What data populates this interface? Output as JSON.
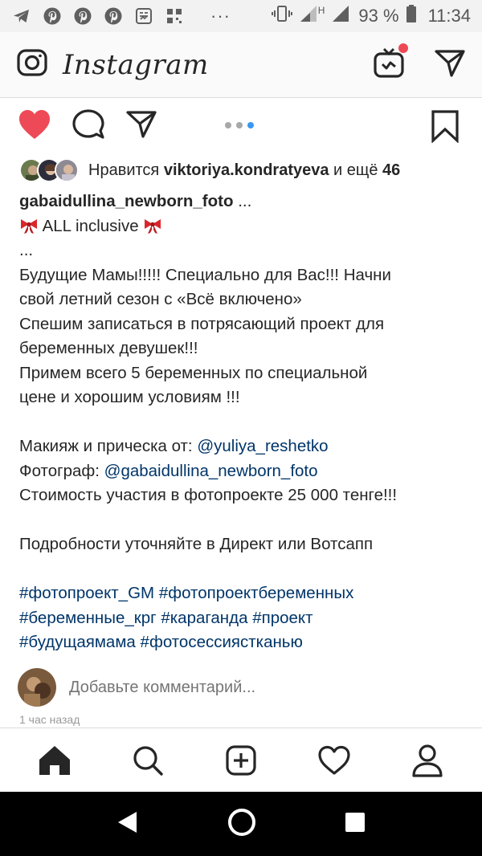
{
  "status_bar": {
    "icons": [
      "telegram-icon",
      "pinterest-icon",
      "pinterest-icon",
      "pinterest-icon",
      "screenshot-icon",
      "qr-icon"
    ],
    "more": "···",
    "network": "H",
    "battery": "93 %",
    "time": "11:34"
  },
  "app": {
    "title": "Instagram"
  },
  "post": {
    "carousel": {
      "count": 3,
      "active_index": 2
    },
    "likes": {
      "prefix": "Нравится",
      "user": "viktoriya.kondratyeva",
      "suffix": "и ещё",
      "count": "46"
    },
    "caption": {
      "username": "gabaidullina_newborn_foto",
      "ellipsis": " ...",
      "title": "ALL inclusive",
      "dots": "...",
      "lines": [
        "Будущие Мамы!!!!! Специально для Вас!!! Начни",
        "свой летний сезон с «Всё включено»",
        "Спешим записаться в потрясающий проект для",
        "беременных девушек!!!",
        "Примем всего 5 беременных по специальной",
        "цене и хорошим условиям !!!"
      ],
      "makeup_label": "Макияж и прическа от: ",
      "makeup_link": "@yuliya_reshetko",
      "photo_label": "Фотограф: ",
      "photo_link": "@gabaidullina_newborn_foto",
      "price_line": "Стоимость участия в фотопроекте 25 000 тенге!!!",
      "details_line": "Подробности уточняйте в Директ или Вотсапп",
      "hashtags": [
        [
          "#фотопроект_GM",
          "#фотопроектбеременных"
        ],
        [
          "#беременные_крг",
          "#караганда",
          "#проект"
        ],
        [
          "#будущаямама",
          "#фотосессиястканью"
        ]
      ]
    },
    "comment_placeholder": "Добавьте комментарий...",
    "timestamp": "1 час назад"
  },
  "colors": {
    "like": "#ed4956",
    "link": "#003569",
    "carousel_active": "#3897f0"
  }
}
